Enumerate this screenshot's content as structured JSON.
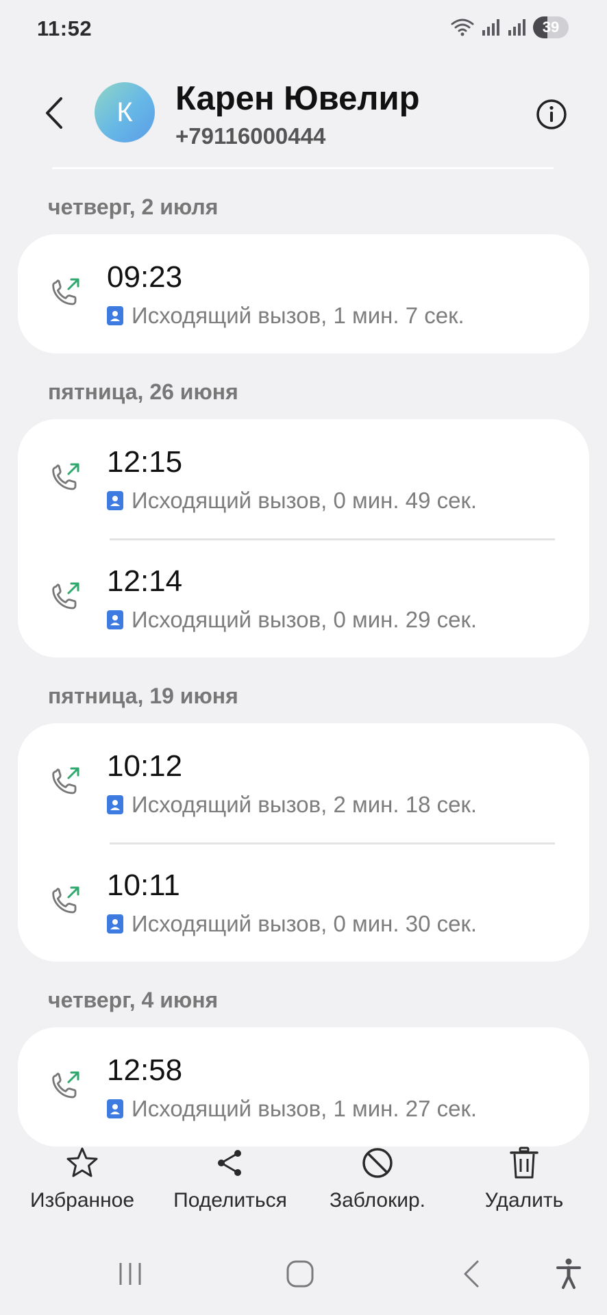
{
  "status_bar": {
    "time": "11:52",
    "battery": "39"
  },
  "header": {
    "contact_name": "Карен Ювелир",
    "avatar_letter": "К",
    "phone": "+79116000444"
  },
  "call_groups": [
    {
      "date": "четверг, 2 июля",
      "calls": [
        {
          "time": "09:23",
          "description": "Исходящий вызов, 1 мин. 7 сек."
        }
      ]
    },
    {
      "date": "пятница, 26 июня",
      "calls": [
        {
          "time": "12:15",
          "description": "Исходящий вызов, 0 мин. 49 сек."
        },
        {
          "time": "12:14",
          "description": "Исходящий вызов, 0 мин. 29 сек."
        }
      ]
    },
    {
      "date": "пятница, 19 июня",
      "calls": [
        {
          "time": "10:12",
          "description": "Исходящий вызов, 2 мин. 18 сек."
        },
        {
          "time": "10:11",
          "description": "Исходящий вызов, 0 мин. 30 сек."
        }
      ]
    },
    {
      "date": "четверг, 4 июня",
      "calls": [
        {
          "time": "12:58",
          "description": "Исходящий вызов, 1 мин. 27 сек."
        }
      ]
    }
  ],
  "actions": {
    "favorite": "Избранное",
    "share": "Поделиться",
    "block": "Заблокир.",
    "delete": "Удалить"
  },
  "icons": {
    "call_direction": "outgoing-call-icon",
    "sim": "sim-card-icon",
    "favorite": "star-icon",
    "share": "share-icon",
    "block": "block-icon",
    "delete": "trash-icon"
  },
  "colors": {
    "background": "#f1f1f4",
    "card": "#ffffff",
    "outgoing_arrow": "#2fa86e",
    "sim_badge": "#3d7be0",
    "secondary_text": "#7d7d7d"
  }
}
